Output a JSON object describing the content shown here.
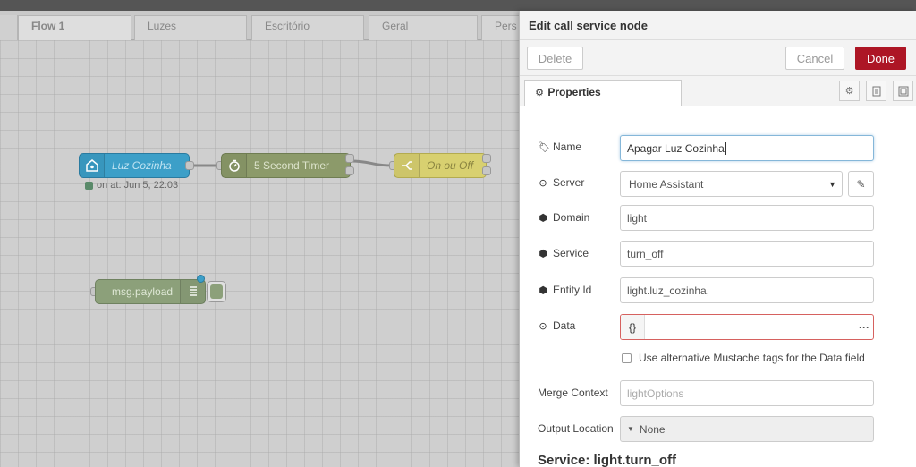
{
  "workspace": {
    "tabs": [
      {
        "label": "Flow 1",
        "active": true
      },
      {
        "label": "Luzes"
      },
      {
        "label": "Escritório"
      },
      {
        "label": "Geral"
      },
      {
        "label": "Pers"
      }
    ],
    "nodes": {
      "luz_cozinha": {
        "label": "Luz Cozinha",
        "status": "on at: Jun 5, 22:03",
        "color": "#3c9fc8"
      },
      "timer": {
        "label": "5 Second Timer",
        "color": "#8c9a6a"
      },
      "switch": {
        "label": "On ou Off",
        "color": "#d8d070"
      },
      "debug": {
        "label": "msg.payload",
        "color": "#8ca07a"
      }
    }
  },
  "dialog": {
    "title": "Edit call service node",
    "delete_label": "Delete",
    "cancel_label": "Cancel",
    "done_label": "Done",
    "tab_label": "Properties",
    "fields": {
      "name": {
        "label": "Name",
        "value": "Apagar Luz Cozinha"
      },
      "server": {
        "label": "Server",
        "value": "Home Assistant"
      },
      "domain": {
        "label": "Domain",
        "value": "light"
      },
      "service": {
        "label": "Service",
        "value": "turn_off"
      },
      "entity": {
        "label": "Entity Id",
        "value": "light.luz_cozinha,"
      },
      "data": {
        "label": "Data",
        "type_label": "{}"
      },
      "mustache": {
        "label": "Use alternative Mustache tags for the Data field"
      },
      "merge": {
        "label": "Merge Context",
        "placeholder": "lightOptions"
      },
      "output": {
        "label": "Output Location",
        "value": "None"
      }
    },
    "service_heading": "Service: light.turn_off"
  },
  "colors": {
    "done": "#ad1625",
    "error_border": "#d6615f",
    "focus_border": "#85b7d9"
  }
}
